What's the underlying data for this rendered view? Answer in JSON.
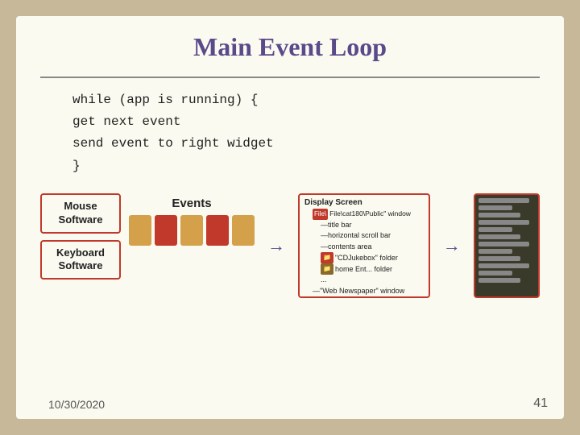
{
  "slide": {
    "title": "Main Event Loop",
    "code": {
      "line1": "while (app is running) {",
      "line2": "    get next event",
      "line3": "    send event to right widget",
      "line4": "}"
    },
    "left_panel": {
      "box1_line1": "Mouse",
      "box1_line2": "Software",
      "box2_line1": "Keyboard",
      "box2_line2": "Software"
    },
    "events_label": "Events",
    "diagram": {
      "title": "Display Screen",
      "window1": "File\\cat180\\Public\" window",
      "item1": "title bar",
      "item2": "horizontal scroll bar",
      "item3": "contents area",
      "folder1": "\"CDJukebox\" folder",
      "folder2": "home Ent... folder",
      "ellipsis1": "...",
      "window2": "\"Web Newspaper\" window",
      "ellipsis2": "..."
    },
    "date": "10/30/2020",
    "page_number": "41"
  },
  "colors": {
    "title": "#5a4a8a",
    "red_border": "#c0392b",
    "bar1": "#d4a04a",
    "bar2": "#c0392b",
    "bar3": "#d4a04a",
    "bar4": "#c0392b",
    "bar5": "#d4a04a"
  }
}
